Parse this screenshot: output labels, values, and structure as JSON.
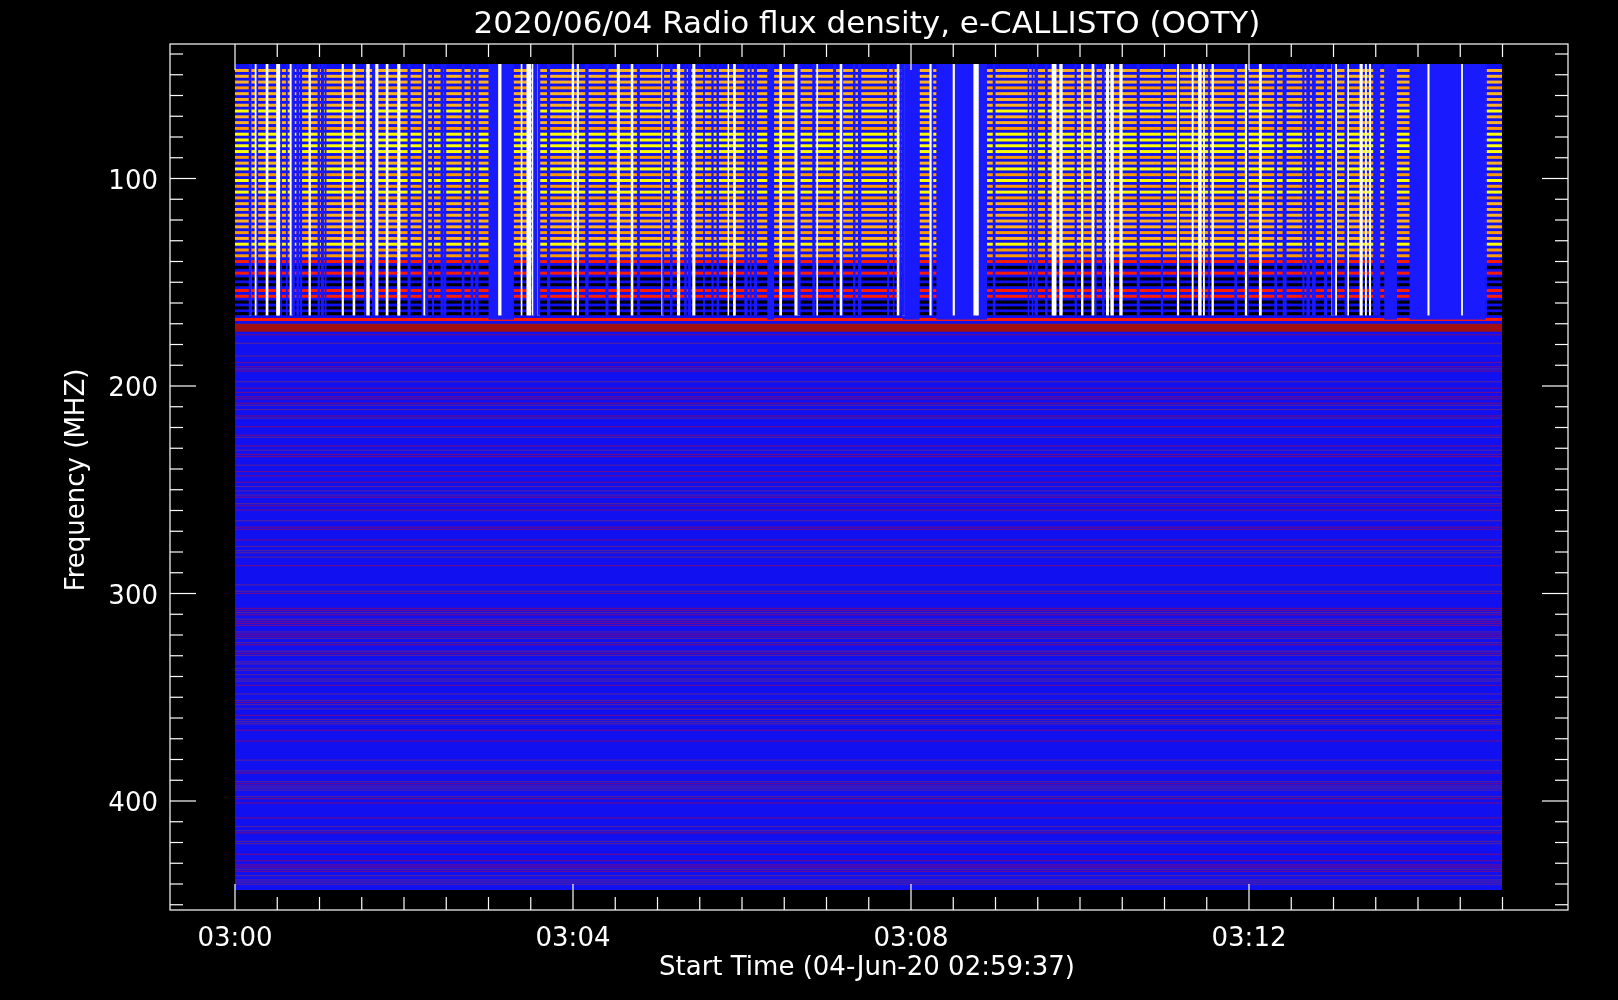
{
  "title": "2020/06/04  Radio flux density, e-CALLISTO (OOTY)",
  "y_axis": {
    "label": "Frequency (MHZ)",
    "ticks": [
      "100",
      "200",
      "300",
      "400"
    ]
  },
  "x_axis": {
    "label": "Start Time (04-Jun-20 02:59:37)",
    "ticks": [
      "03:00",
      "03:04",
      "03:08",
      "03:12"
    ]
  }
}
